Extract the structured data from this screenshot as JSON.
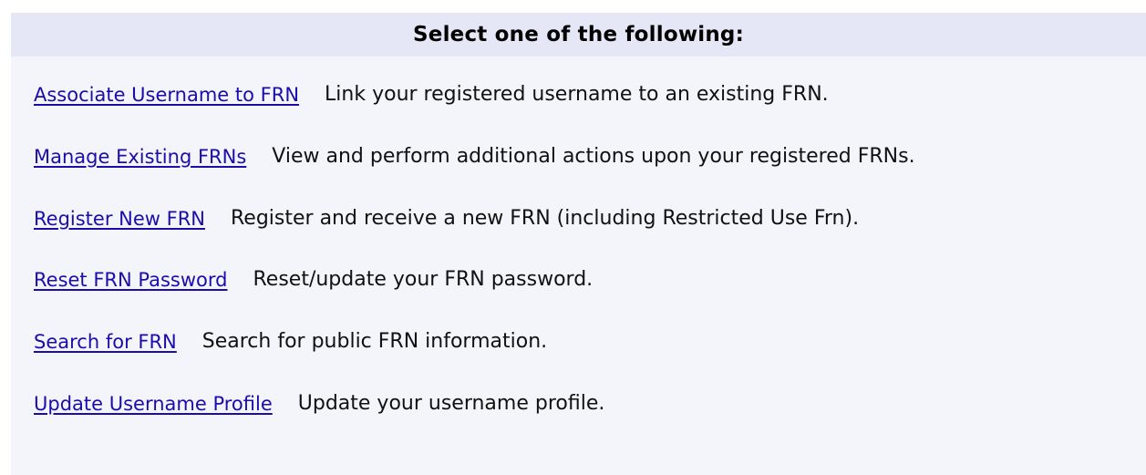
{
  "panel": {
    "title": "Select one of the following:"
  },
  "options": [
    {
      "link": "Associate Username to FRN",
      "description": "Link your registered username to an existing FRN."
    },
    {
      "link": "Manage Existing FRNs",
      "description": "View and perform additional actions upon your registered FRNs."
    },
    {
      "link": "Register New FRN",
      "description": "Register and receive a new FRN (including Restricted Use Frn)."
    },
    {
      "link": "Reset FRN Password",
      "description": "Reset/update your FRN password."
    },
    {
      "link": "Search for FRN",
      "description": "Search for public FRN information."
    },
    {
      "link": "Update Username Profile",
      "description": "Update your username profile."
    }
  ],
  "colors": {
    "link": "#1a0dab",
    "header_bg": "#e5e7f6",
    "panel_bg": "#f4f5fb"
  }
}
